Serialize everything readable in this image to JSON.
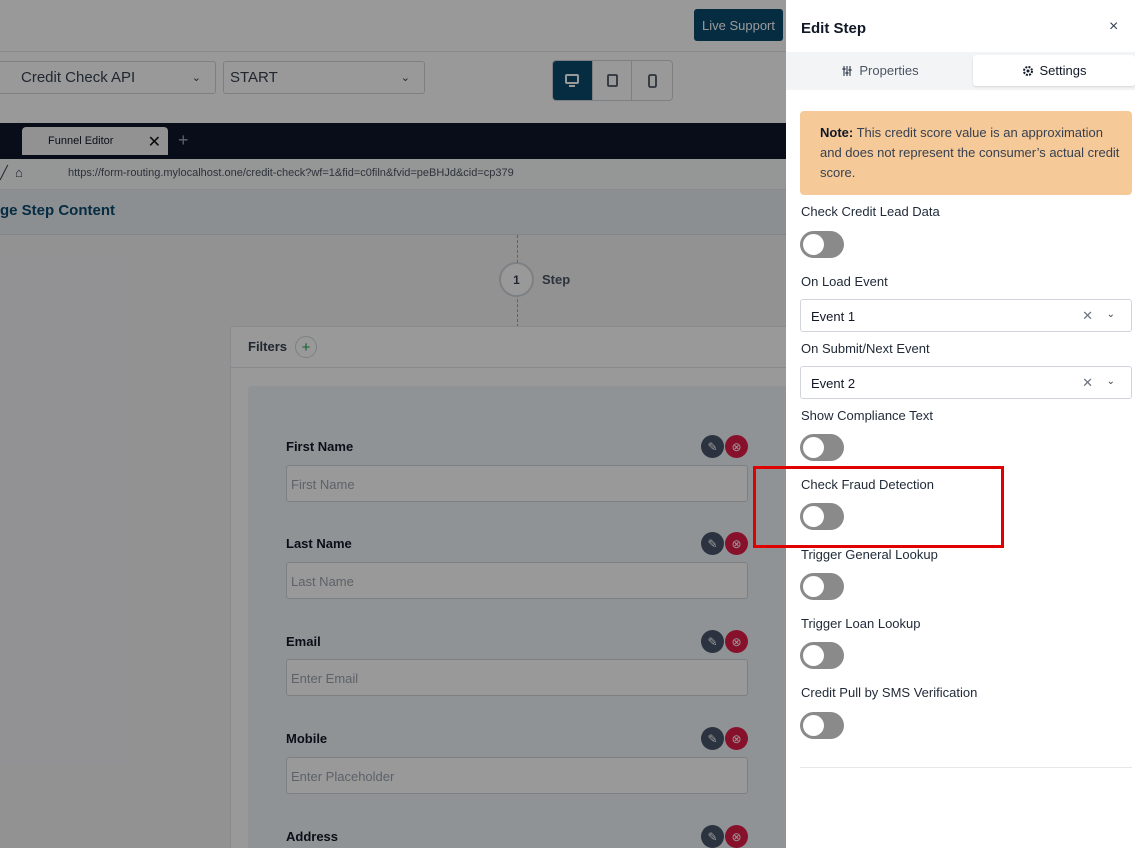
{
  "header": {
    "live_support_label": "Live Support"
  },
  "toolbar": {
    "select_api": "Credit Check API",
    "select_step": "START",
    "devices": [
      "desktop-icon",
      "tablet-icon",
      "mobile-icon"
    ]
  },
  "browser": {
    "tab_label": "Funnel Editor",
    "url": "https://form-routing.mylocalhost.one/credit-check?wf=1&fid=c0filn&fvid=peBHJd&cid=cp379"
  },
  "page_header": {
    "title": "ge Step Content"
  },
  "step": {
    "number": "1",
    "label": "Step"
  },
  "filters": {
    "label": "Filters"
  },
  "form_fields": [
    {
      "label": "First Name",
      "placeholder": "First Name"
    },
    {
      "label": "Last Name",
      "placeholder": "Last Name"
    },
    {
      "label": "Email",
      "placeholder": "Enter Email"
    },
    {
      "label": "Mobile",
      "placeholder": "Enter Placeholder"
    },
    {
      "label": "Address",
      "placeholder": ""
    }
  ],
  "drawer": {
    "title": "Edit Step",
    "close_label": "×",
    "tabs": [
      {
        "label": "Properties",
        "active": false
      },
      {
        "label": "Settings",
        "active": true
      }
    ],
    "note_bold": "Note:",
    "note_text": " This credit score value is an approximation and does not represent the consumer’s actual credit score.",
    "check_credit_label": "Check Credit Lead Data",
    "on_load_label": "On Load Event",
    "on_load_value": "Event 1",
    "on_submit_label": "On Submit/Next Event",
    "on_submit_value": "Event 2",
    "compliance_label": "Show Compliance Text",
    "fraud_label": "Check Fraud Detection",
    "general_lookup_label": "Trigger General Lookup",
    "loan_lookup_label": "Trigger Loan Lookup",
    "sms_label": "Credit Pull by SMS Verification"
  },
  "colors": {
    "primary": "#0b4a6f",
    "note_bg": "#f5c998",
    "toggle_off": "#8a8a8a",
    "highlight": "#e00000",
    "delete": "#e11d48"
  }
}
